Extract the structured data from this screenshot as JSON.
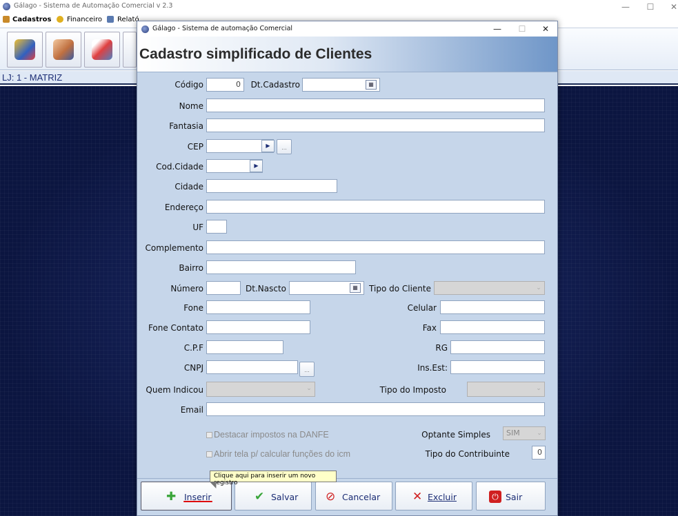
{
  "main_window": {
    "title": "Gálago - Sistema de Automação Comercial v 2.3",
    "controls": {
      "minimize": "—",
      "maximize": "☐",
      "close": "✕"
    }
  },
  "menubar": {
    "items": [
      {
        "label": "Cadastros",
        "icon": "people-icon"
      },
      {
        "label": "Financeiro",
        "icon": "coins-icon"
      },
      {
        "label": "Relató",
        "icon": "report-icon"
      }
    ]
  },
  "store": {
    "label": "LJ: 1 - MATRIZ"
  },
  "dialog": {
    "title": "Gálago - Sistema de automação Comercial",
    "controls": {
      "minimize": "—",
      "maximize": "☐",
      "close": "✕"
    },
    "header": "Cadastro simplificado de Clientes"
  },
  "form": {
    "codigo": {
      "label": "Código",
      "value": "0"
    },
    "dt_cadastro": {
      "label": "Dt.Cadastro",
      "value": ""
    },
    "nome": {
      "label": "Nome",
      "value": ""
    },
    "fantasia": {
      "label": "Fantasia",
      "value": ""
    },
    "cep": {
      "label": "CEP",
      "value": "",
      "ellipsis": "..."
    },
    "cod_cidade": {
      "label": "Cod.Cidade",
      "value": ""
    },
    "cidade": {
      "label": "Cidade",
      "value": ""
    },
    "endereco": {
      "label": "Endereço",
      "value": ""
    },
    "uf": {
      "label": "UF",
      "value": ""
    },
    "complemento": {
      "label": "Complemento",
      "value": ""
    },
    "bairro": {
      "label": "Bairro",
      "value": ""
    },
    "numero": {
      "label": "Número",
      "value": ""
    },
    "dt_nascto": {
      "label": "Dt.Nascto",
      "value": ""
    },
    "tipo_cliente": {
      "label": "Tipo do Cliente",
      "value": ""
    },
    "fone": {
      "label": "Fone",
      "value": ""
    },
    "celular": {
      "label": "Celular",
      "value": ""
    },
    "fone_contato": {
      "label": "Fone Contato",
      "value": ""
    },
    "fax": {
      "label": "Fax",
      "value": ""
    },
    "cpf": {
      "label": "C.P.F",
      "value": ""
    },
    "rg": {
      "label": "RG",
      "value": ""
    },
    "cnpj": {
      "label": "CNPJ",
      "value": "",
      "ellipsis": "..."
    },
    "ins_est": {
      "label": "Ins.Est:",
      "value": ""
    },
    "quem_indicou": {
      "label": "Quem Indicou",
      "value": ""
    },
    "tipo_imposto": {
      "label": "Tipo do Imposto",
      "value": ""
    },
    "email": {
      "label": "Email",
      "value": ""
    },
    "destacar_impostos": {
      "label": "Destacar impostos na DANFE",
      "checked": false
    },
    "abrir_tela": {
      "label": "Abrir tela p/ calcular funções do icm",
      "checked": false
    },
    "optante_simples": {
      "label": "Optante Simples",
      "value": "SIM"
    },
    "tipo_contribuinte": {
      "label": "Tipo do Contribuinte",
      "value": "0"
    }
  },
  "buttons": {
    "inserir": "Inserir",
    "salvar": "Salvar",
    "cancelar": "Cancelar",
    "excluir": "Excluir",
    "sair": "Sair"
  },
  "tooltip": "Clique aqui para inserir um novo registro",
  "colors": {
    "form_bg": "#c6d6ea",
    "desktop_bg": "#0c1845",
    "store_text": "#1b2c74",
    "green": "#3aa53a",
    "red": "#d02020"
  }
}
